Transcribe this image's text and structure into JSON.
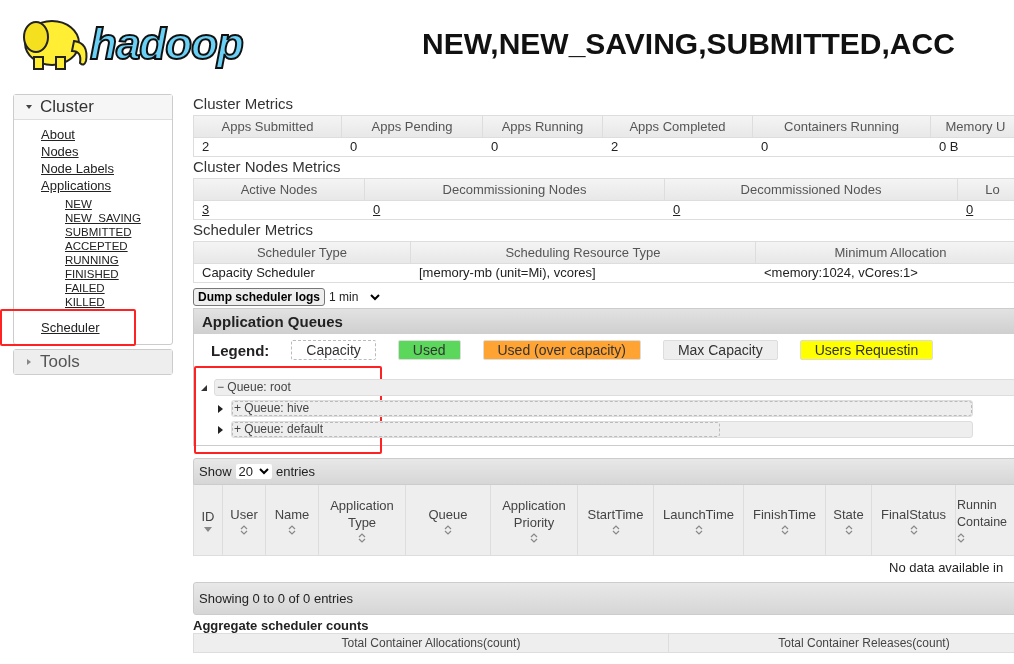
{
  "logo": {
    "text": "hadoop"
  },
  "page_title": "NEW,NEW_SAVING,SUBMITTED,ACC",
  "sidebar": [
    {
      "label": "Cluster",
      "expanded": true,
      "items": [
        {
          "label": "About",
          "highlighted": false
        },
        {
          "label": "Nodes",
          "highlighted": false
        },
        {
          "label": "Node Labels",
          "highlighted": false
        },
        {
          "label": "Applications",
          "highlighted": false,
          "children": [
            {
              "label": "NEW"
            },
            {
              "label": "NEW_SAVING"
            },
            {
              "label": "SUBMITTED"
            },
            {
              "label": "ACCEPTED"
            },
            {
              "label": "RUNNING"
            },
            {
              "label": "FINISHED"
            },
            {
              "label": "FAILED"
            },
            {
              "label": "KILLED"
            }
          ]
        },
        {
          "label": "Scheduler",
          "highlighted": true
        }
      ]
    },
    {
      "label": "Tools",
      "expanded": false
    }
  ],
  "metrics": [
    {
      "title": "Cluster Metrics",
      "kind": "text",
      "columns": [
        "Apps Submitted",
        "Apps Pending",
        "Apps Running",
        "Apps Completed",
        "Containers Running",
        "Memory U"
      ],
      "values": [
        "2",
        "0",
        "0",
        "2",
        "0",
        "0 B"
      ]
    },
    {
      "title": "Cluster Nodes Metrics",
      "kind": "link",
      "columns": [
        "Active Nodes",
        "Decommissioning Nodes",
        "Decommissioned Nodes",
        "Lo"
      ],
      "values": [
        "3",
        "0",
        "0",
        "0"
      ]
    },
    {
      "title": "Scheduler Metrics",
      "kind": "text",
      "columns": [
        "Scheduler Type",
        "Scheduling Resource Type",
        "Minimum Allocation"
      ],
      "values": [
        "Capacity Scheduler",
        "[memory-mb (unit=Mi), vcores]",
        "<memory:1024, vCores:1>"
      ]
    }
  ],
  "dump_button": "Dump scheduler logs",
  "dump_interval": "1 min",
  "queues": {
    "title": "Application Queues",
    "legend_label": "Legend:",
    "legend": [
      {
        "label": "Capacity",
        "kind": "outline",
        "color": "#ffffff"
      },
      {
        "label": "Used",
        "kind": "fill",
        "color": "#5bd75b"
      },
      {
        "label": "Used (over capacity)",
        "kind": "fill",
        "color": "#ffa333"
      },
      {
        "label": "Max Capacity",
        "kind": "fill",
        "color": "#eeeeee"
      },
      {
        "label": "Users Requestin",
        "kind": "fill",
        "color": "#ffff00"
      }
    ],
    "highlighted": true,
    "tree": [
      {
        "sign": "−",
        "label": "Queue: root",
        "expanded": true,
        "level": 1,
        "children": [
          {
            "sign": "+",
            "label": "Queue: hive",
            "expanded": false,
            "level": 1
          },
          {
            "sign": "+",
            "label": "Queue: default",
            "expanded": false,
            "level": 0.66
          }
        ]
      }
    ]
  },
  "apps": {
    "show_label": "Show",
    "page_size": "20",
    "entries_label": "entries",
    "columns": [
      {
        "label": "ID",
        "sorted": true
      },
      {
        "label": "User",
        "sorted": false
      },
      {
        "label": "Name",
        "sorted": false
      },
      {
        "label": "Application Type",
        "sorted": false
      },
      {
        "label": "Queue",
        "sorted": false
      },
      {
        "label": "Application Priority",
        "sorted": false
      },
      {
        "label": "StartTime",
        "sorted": false
      },
      {
        "label": "LaunchTime",
        "sorted": false
      },
      {
        "label": "FinishTime",
        "sorted": false
      },
      {
        "label": "State",
        "sorted": false
      },
      {
        "label": "FinalStatus",
        "sorted": false
      },
      {
        "label": "Runnin Containe",
        "sorted": false
      }
    ],
    "empty_text": "No data available in",
    "info": "Showing 0 to 0 of 0 entries"
  },
  "aggregate": {
    "title": "Aggregate scheduler counts",
    "columns": [
      "Total Container Allocations(count)",
      "Total Container Releases(count)"
    ]
  }
}
